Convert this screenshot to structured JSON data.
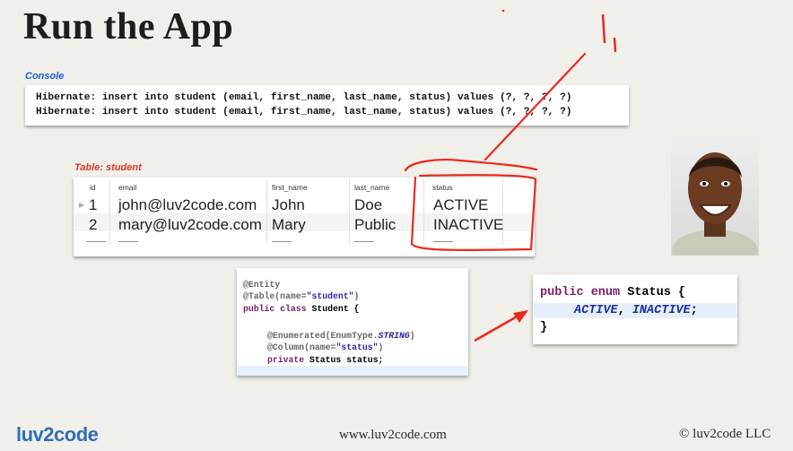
{
  "slide": {
    "title": "Run the App",
    "console_label": "Console",
    "console_lines": [
      "Hibernate: insert into student (email, first_name, last_name, status) values (?, ?, ?, ?)",
      "Hibernate: insert into student (email, first_name, last_name, status) values (?, ?, ?, ?)"
    ],
    "table_label": "Table: student",
    "table": {
      "columns": [
        "id",
        "email",
        "first_name",
        "last_name",
        "status"
      ],
      "rows": [
        [
          "1",
          "john@luv2code.com",
          "John",
          "Doe",
          "ACTIVE"
        ],
        [
          "2",
          "mary@luv2code.com",
          "Mary",
          "Public",
          "INACTIVE"
        ]
      ]
    },
    "code": {
      "entity": "@Entity",
      "table_prefix": "@Table(name=",
      "table_value": "\"student\"",
      "table_suffix": ")",
      "class_kw": "public class",
      "class_name": " Student {",
      "enumerated_prefix": "@Enumerated(EnumType.",
      "enumerated_value": "STRING",
      "enumerated_suffix": ")",
      "column_prefix": "@Column(name=",
      "column_value": "\"status\"",
      "column_suffix": ")",
      "field_kw": "private",
      "field_rest": " Status status;"
    },
    "enum_code": {
      "kw": "public enum",
      "name": " Status {",
      "values_active": "ACTIVE",
      "values_sep": ", ",
      "values_inactive": "INACTIVE",
      "values_end": ";",
      "close": "}"
    },
    "footer": {
      "logo": "luv2code",
      "url": "www.luv2code.com",
      "copyright": "© luv2code LLC"
    },
    "colors": {
      "annotation_red": "#e8291c",
      "console_label": "#1a5fd0",
      "table_label": "#d23a2a",
      "keyword": "#7b1f66",
      "enum_value": "#1b2fa0"
    }
  }
}
